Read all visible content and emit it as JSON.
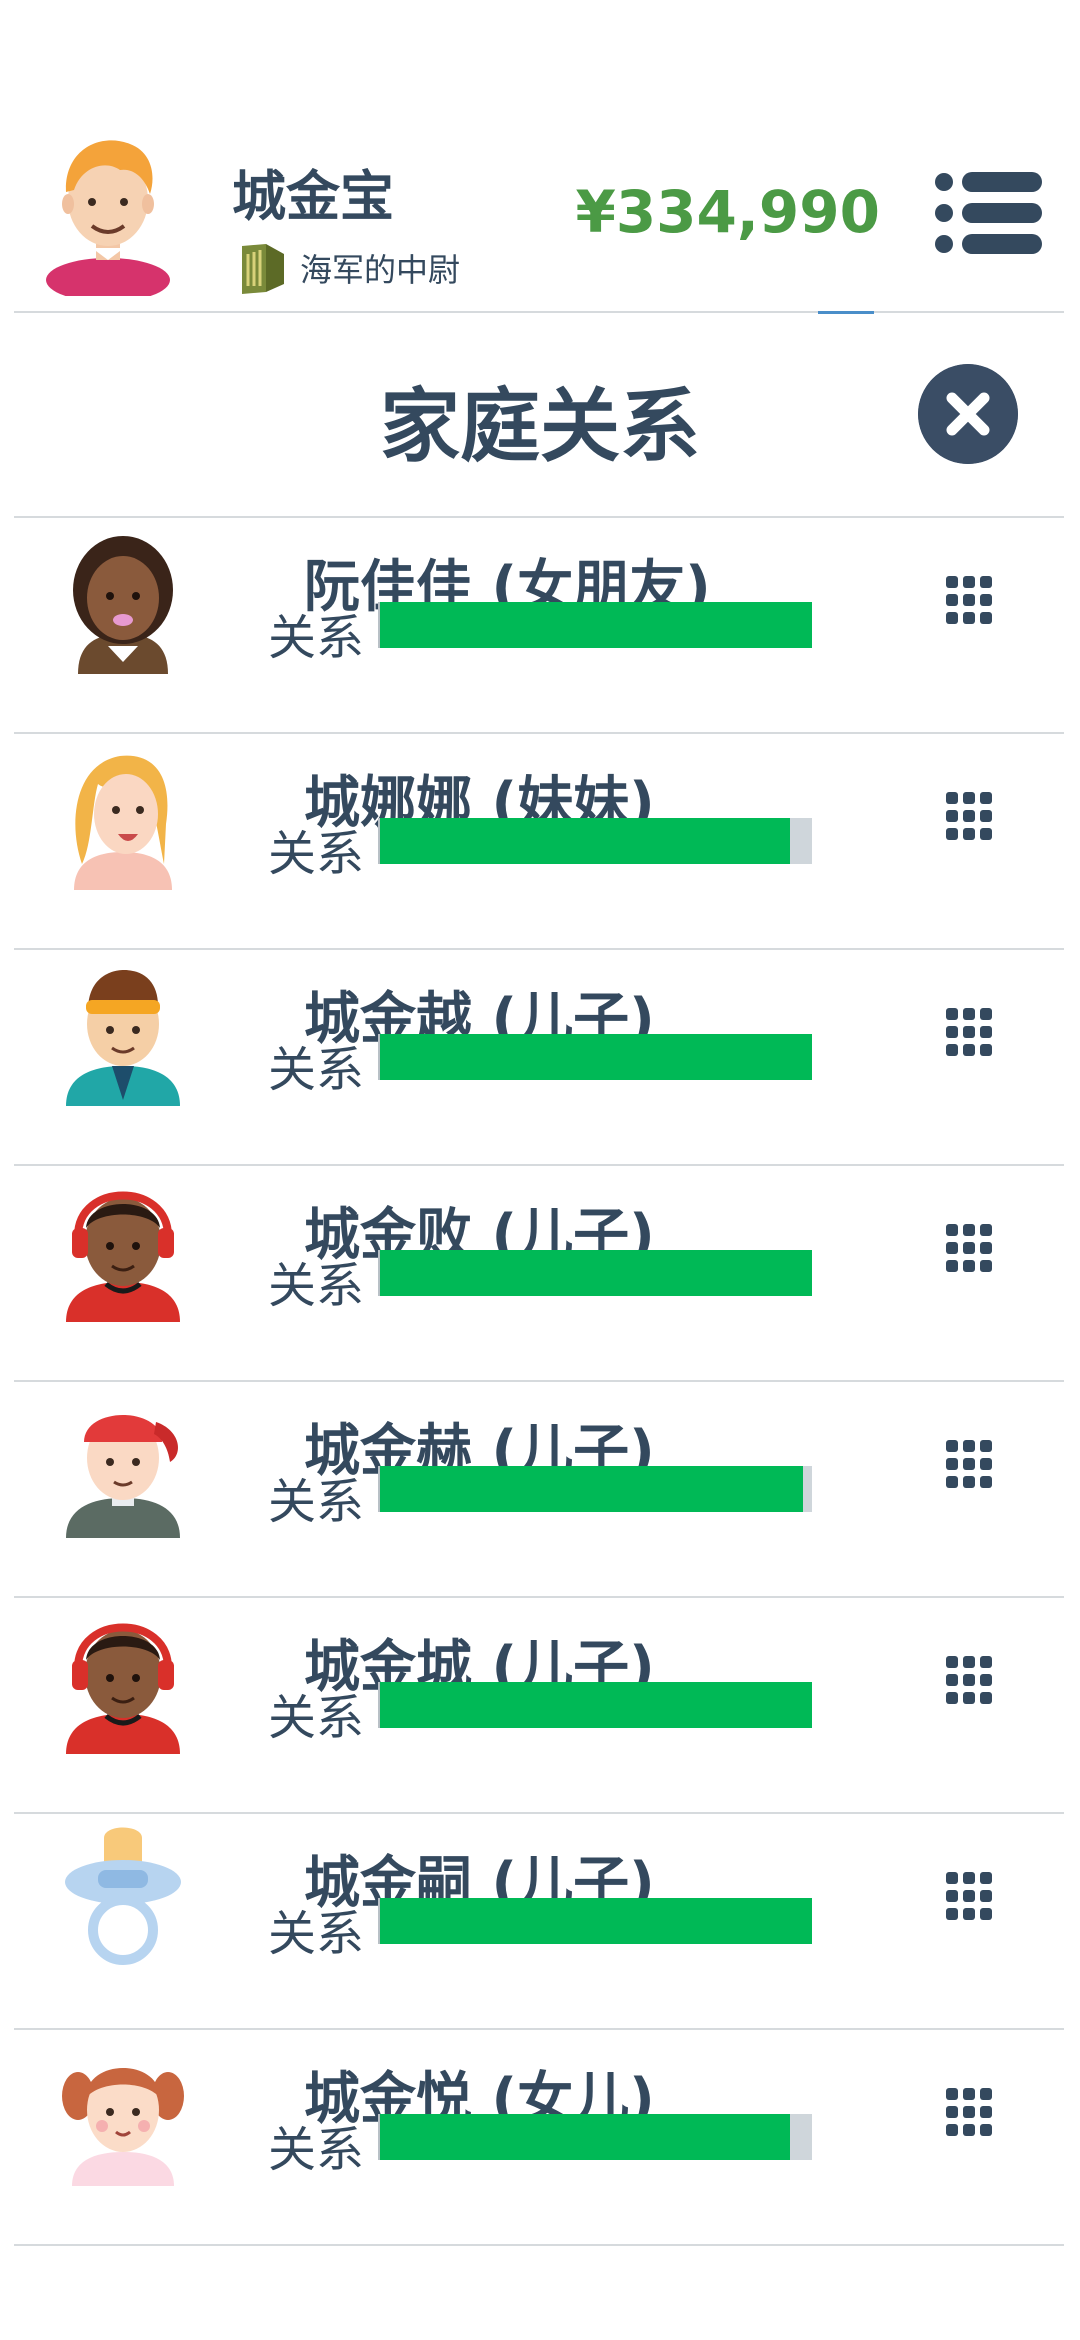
{
  "header": {
    "name": "城金宝",
    "rank": "海军的中尉",
    "money": "¥334,990"
  },
  "title": "家庭关系",
  "relation_label": "关系",
  "members": [
    {
      "name": "阮佳佳 (女朋友)",
      "relation": 1.0,
      "avatar": "woman-dark-avatar"
    },
    {
      "name": "城娜娜 (妹妹)",
      "relation": 0.95,
      "avatar": "woman-blonde-avatar"
    },
    {
      "name": "城金越 (儿子)",
      "relation": 1.0,
      "avatar": "boy-headband-avatar"
    },
    {
      "name": "城金败 (儿子)",
      "relation": 1.0,
      "avatar": "boy-headphones-avatar"
    },
    {
      "name": "城金赫 (儿子)",
      "relation": 0.98,
      "avatar": "boy-cap-avatar"
    },
    {
      "name": "城金城 (儿子)",
      "relation": 1.0,
      "avatar": "boy-headphones-avatar"
    },
    {
      "name": "城金嗣 (儿子)",
      "relation": 1.0,
      "avatar": "baby-pacifier-avatar"
    },
    {
      "name": "城金悦 (女儿)",
      "relation": 0.95,
      "avatar": "girl-pigtails-avatar"
    }
  ],
  "colors": {
    "text": "#34495e",
    "money": "#4b9a45",
    "bar_fill": "#00b956",
    "bar_track": "#cfd6db",
    "close_bg": "#3a4d65"
  }
}
